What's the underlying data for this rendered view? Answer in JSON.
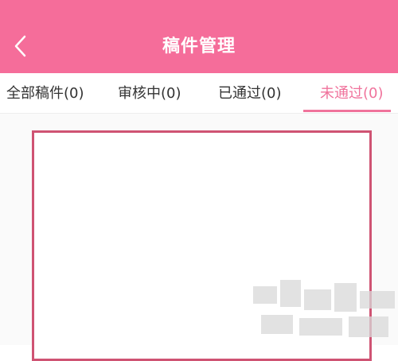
{
  "header": {
    "title": "稿件管理",
    "back_icon": "chevron-left-icon",
    "background_color": "#f56d9a"
  },
  "tabs": [
    {
      "label": "全部稿件(0)",
      "active": false
    },
    {
      "label": "审核中(0)",
      "active": false
    },
    {
      "label": "已通过(0)",
      "active": false
    },
    {
      "label": "未通过(0)",
      "active": true
    }
  ],
  "colors": {
    "accent": "#f0739c",
    "frame_border": "#cf5373"
  }
}
